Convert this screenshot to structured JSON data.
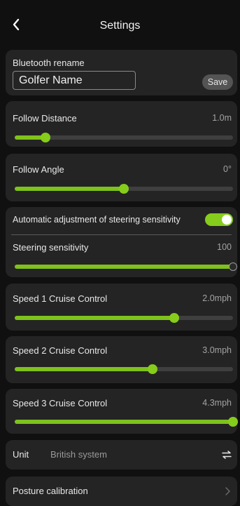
{
  "header": {
    "title": "Settings",
    "back_icon": "chevron-left-icon"
  },
  "bluetooth": {
    "label": "Bluetooth rename",
    "name_value": "Golfer Name",
    "save_label": "Save"
  },
  "follow_distance": {
    "label": "Follow Distance",
    "value": "1.0m",
    "level": 0.14
  },
  "follow_angle": {
    "label": "Follow Angle",
    "value": "0°",
    "level": 0.5
  },
  "steering": {
    "auto_label": "Automatic adjustment of steering sensitivity",
    "auto_enabled": true,
    "sensitivity_label": "Steering sensitivity",
    "sensitivity_value": "100",
    "level": 1.0
  },
  "speed1": {
    "label": "Speed 1 Cruise Control",
    "value": "2.0mph",
    "level": 0.73
  },
  "speed2": {
    "label": "Speed 2 Cruise Control",
    "value": "3.0mph",
    "level": 0.63
  },
  "speed3": {
    "label": "Speed 3 Cruise Control",
    "value": "4.3mph",
    "level": 1.0
  },
  "unit": {
    "label": "Unit",
    "value": "British system",
    "icon": "swap-icon"
  },
  "posture": {
    "label": "Posture calibration",
    "icon": "chevron-right-icon"
  },
  "colors": {
    "accent": "#86cc1c",
    "card": "#242424",
    "background": "#101010",
    "track": "#3f3f3f"
  }
}
